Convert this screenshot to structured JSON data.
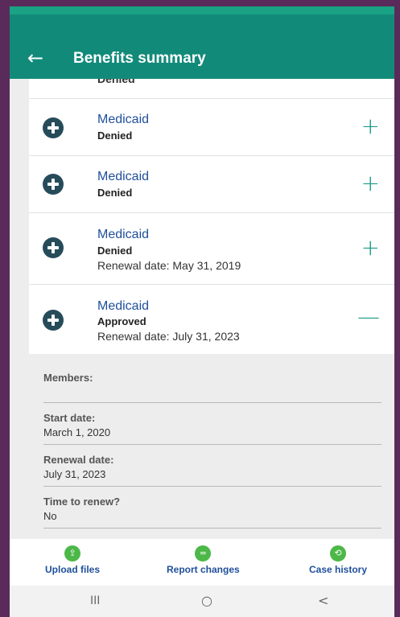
{
  "header": {
    "back_icon": "←",
    "title": "Benefits summary"
  },
  "benefits": {
    "peek_status": "Denied",
    "items": [
      {
        "program": "Medicaid",
        "status": "Denied",
        "renewal": "",
        "toggle": "+"
      },
      {
        "program": "Medicaid",
        "status": "Denied",
        "renewal": "",
        "toggle": "+"
      },
      {
        "program": "Medicaid",
        "status": "Denied",
        "renewal": "Renewal date: May 31, 2019",
        "toggle": "+"
      },
      {
        "program": "Medicaid",
        "status": "Approved",
        "renewal": "Renewal date: July 31, 2023",
        "toggle": "—"
      }
    ]
  },
  "details": {
    "members_label": "Members:",
    "start_label": "Start date:",
    "start_value": "March 1, 2020",
    "renewal_label": "Renewal date:",
    "renewal_value": "July 31, 2023",
    "time_label": "Time to renew?",
    "time_value": "No"
  },
  "bottom_nav": {
    "upload": {
      "label": "Upload files",
      "icon": "upload-icon",
      "glyph": "⇪"
    },
    "report": {
      "label": "Report changes",
      "icon": "report-icon",
      "glyph": "="
    },
    "history": {
      "label": "Case history",
      "icon": "history-icon",
      "glyph": "⟲"
    }
  },
  "system_nav": {
    "recent": "III",
    "home": "○",
    "back": "<"
  },
  "colors": {
    "header_bg": "#128a7a",
    "accent_green": "#4cb848",
    "link_blue": "#1f4f9a",
    "plus_teal": "#1a9a88",
    "icon_circle": "#264c5a"
  }
}
